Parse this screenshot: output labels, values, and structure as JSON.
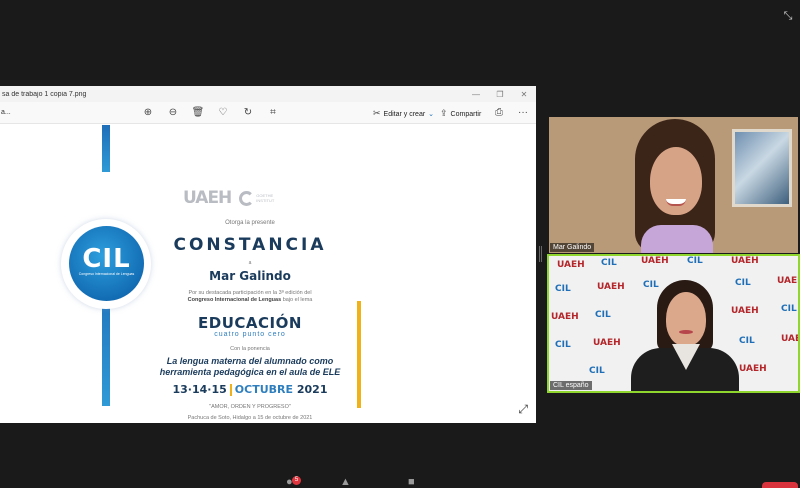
{
  "meeting": {
    "fullscreen_icon": "fullscreen-exit-icon"
  },
  "photo_viewer": {
    "window_title": "sa de trabajo 1 copia 7.png",
    "back_label": "a...",
    "toolbar": {
      "zoom_in_icon": "zoom-in-icon",
      "zoom_out_icon": "zoom-out-icon",
      "delete_icon": "trash-icon",
      "favorite_icon": "heart-icon",
      "rotate_icon": "rotate-icon",
      "crop_icon": "crop-icon",
      "edit_label": "Editar y crear",
      "share_label": "Compartir",
      "print_icon": "print-icon",
      "more_label": "···"
    }
  },
  "certificate": {
    "logo_uaeh": "UAEH",
    "logo_goethe": [
      "GOETHE",
      "INSTITUT"
    ],
    "cil_logo": "CIL",
    "cil_caption": "Congreso Internacional de Lenguas",
    "otorga": "Otorga la presente",
    "title": "CONSTANCIA",
    "a": "a",
    "recipient": "Mar Galindo",
    "por_line1": "Por su destacada participación en la 3ª edición del",
    "por_line2_bold": "Congreso Internacional de Lenguas",
    "por_line2_rest": " bajo el lema",
    "theme": "EDUCACIÓN",
    "theme_sub": "cuatro punto cero",
    "ponencia": "Con la ponencia",
    "talk_line1": "La lengua materna del alumnado como",
    "talk_line2": "herramienta pedagógica en el aula de ELE",
    "dates": "13·14·15",
    "month": "OCTUBRE",
    "year": "2021",
    "lema": "\"AMOR, ORDEN Y PROGRESO\"",
    "lugar": "Pachuca de Soto, Hidalgo a 15 de octubre de 2021"
  },
  "participants": [
    {
      "name": "Mar Galindo"
    },
    {
      "name": "CIL españo"
    }
  ],
  "banner_words": [
    "UAEH",
    "CIL"
  ],
  "bottom_bar": {
    "chat_badge": "5"
  }
}
